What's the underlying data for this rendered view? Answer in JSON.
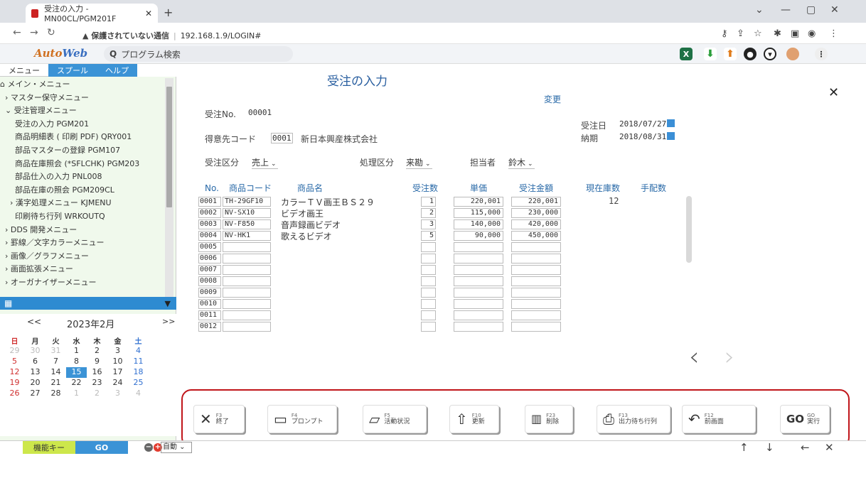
{
  "browser": {
    "tab_title": "受注の入力 - MN00CL/PGM201F",
    "url_warning": "▲ 保護されていない通信",
    "url": "192.168.1.9/LOGIN#"
  },
  "app": {
    "logo_a": "Auto",
    "logo_b": "Web",
    "search_placeholder": "プログラム検索"
  },
  "sidebar": {
    "tabs": [
      "メニュー",
      "スプール",
      "ヘルプ"
    ],
    "items": [
      "⌂ メイン・メニュー",
      "  › マスター保守メニュー",
      "  ⌄ 受注管理メニュー",
      "      受注の入力 PGM201",
      "      商品明細表 ( 印刷 PDF) QRY001",
      "      部品マスターの登録 PGM107",
      "      商品在庫照会 (*SFLCHK) PGM203",
      "      部品仕入の入力 PNL008",
      "      部品在庫の照会 PGM209CL",
      "    › 漢字処理メニュー KJMENU",
      "      印刷待ち行列 WRKOUTQ",
      "  › DDS 開発メニュー",
      "  › 罫線／文字カラーメニュー",
      "  › 画像／グラフメニュー",
      "  › 画面拡張メニュー",
      "  › オーガナイザーメニュー"
    ],
    "calendar": {
      "prev": "<<",
      "next": ">>",
      "month": "2023年2月",
      "weekdays": [
        "日",
        "月",
        "火",
        "水",
        "木",
        "金",
        "土"
      ],
      "days": [
        [
          "29",
          "30",
          "31",
          "1",
          "2",
          "3",
          "4"
        ],
        [
          "5",
          "6",
          "7",
          "8",
          "9",
          "10",
          "11"
        ],
        [
          "12",
          "13",
          "14",
          "15",
          "16",
          "17",
          "18"
        ],
        [
          "19",
          "20",
          "21",
          "22",
          "23",
          "24",
          "25"
        ],
        [
          "26",
          "27",
          "28",
          "1",
          "2",
          "3",
          "4"
        ]
      ],
      "today": "15"
    }
  },
  "form": {
    "title": "受注の入力",
    "mode": "変更",
    "order_no_label": "受注No.",
    "order_no": "00001",
    "order_date_label": "受注日",
    "order_date": "2018/07/27",
    "due_label": "納期",
    "due_date": "2018/08/31",
    "customer_label": "得意先コード",
    "customer_code": "0001",
    "customer_name": "新日本興産株式会社",
    "order_type_label": "受注区分",
    "order_type": "売上",
    "proc_label": "処理区分",
    "proc": "来勘",
    "staff_label": "担当者",
    "staff": "鈴木",
    "columns": [
      "No.",
      "商品コード",
      "商品名",
      "受注数",
      "単価",
      "受注金額",
      "現在庫数",
      "手配数"
    ],
    "rows": [
      {
        "no": "0001",
        "code": "TH-29GF10",
        "name": "カラーＴＶ画王ＢＳ２９",
        "qty": "1",
        "price": "220,001",
        "amount": "220,001",
        "stock": "12"
      },
      {
        "no": "0002",
        "code": "NV-SX10",
        "name": "ビデオ画王",
        "qty": "2",
        "price": "115,000",
        "amount": "230,000",
        "stock": ""
      },
      {
        "no": "0003",
        "code": "NV-F850",
        "name": "音声録画ビデオ",
        "qty": "3",
        "price": "140,000",
        "amount": "420,000",
        "stock": ""
      },
      {
        "no": "0004",
        "code": "NV-HK1",
        "name": "歌えるビデオ",
        "qty": "5",
        "price": "90,000",
        "amount": "450,000",
        "stock": ""
      },
      {
        "no": "0005",
        "code": "",
        "name": "",
        "qty": "",
        "price": "",
        "amount": "",
        "stock": ""
      },
      {
        "no": "0006",
        "code": "",
        "name": "",
        "qty": "",
        "price": "",
        "amount": "",
        "stock": ""
      },
      {
        "no": "0007",
        "code": "",
        "name": "",
        "qty": "",
        "price": "",
        "amount": "",
        "stock": ""
      },
      {
        "no": "0008",
        "code": "",
        "name": "",
        "qty": "",
        "price": "",
        "amount": "",
        "stock": ""
      },
      {
        "no": "0009",
        "code": "",
        "name": "",
        "qty": "",
        "price": "",
        "amount": "",
        "stock": ""
      },
      {
        "no": "0010",
        "code": "",
        "name": "",
        "qty": "",
        "price": "",
        "amount": "",
        "stock": ""
      },
      {
        "no": "0011",
        "code": "",
        "name": "",
        "qty": "",
        "price": "",
        "amount": "",
        "stock": ""
      },
      {
        "no": "0012",
        "code": "",
        "name": "",
        "qty": "",
        "price": "",
        "amount": "",
        "stock": ""
      }
    ]
  },
  "fkeys": [
    {
      "key": "F3",
      "label": "終了",
      "icon": "✕"
    },
    {
      "key": "F4",
      "label": "プロンプト",
      "icon": "▭"
    },
    {
      "key": "F5",
      "label": "活動状況",
      "icon": "▱"
    },
    {
      "key": "F10",
      "label": "更新",
      "icon": "⇧"
    },
    {
      "key": "F23",
      "label": "削除",
      "icon": "🗑"
    },
    {
      "key": "F13",
      "label": "出力待ち行列",
      "icon": "⎙"
    },
    {
      "key": "F12",
      "label": "前画面",
      "icon": "↶"
    },
    {
      "key": "GO",
      "label": "実行",
      "icon": "GO"
    }
  ],
  "bottom": {
    "func_key": "機能キー",
    "go": "GO",
    "auto": "自動"
  }
}
